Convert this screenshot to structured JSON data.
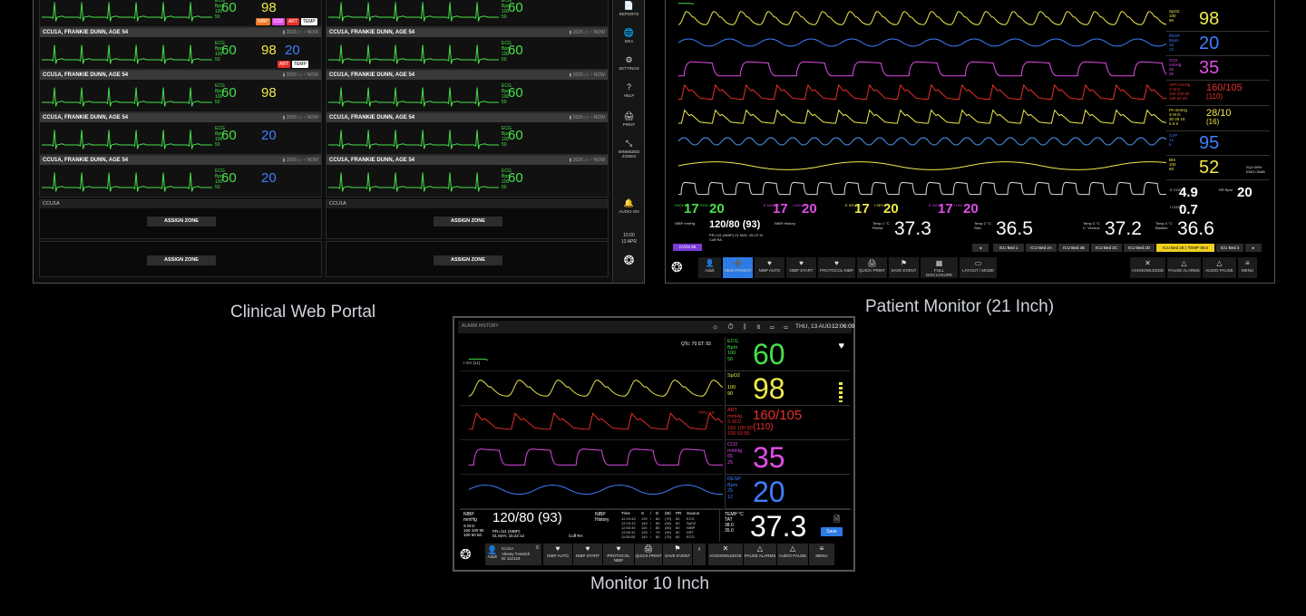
{
  "labels": {
    "portal": "Clinical Web Portal",
    "pm21": "Patient Monitor (21 Inch)",
    "m10": "Monitor 10 Inch"
  },
  "colors": {
    "ecg": "#47e04a",
    "spo2": "#f0e94a",
    "resp": "#3f7fff",
    "co2": "#e14ce8",
    "art": "#e8302a",
    "cvp": "#4aa0ff",
    "temp": "#ffffff",
    "accent": "#2c7be5"
  },
  "portal": {
    "patients": [
      {
        "name": "CCU1A, FRANKIE DUNN, AGE 54",
        "hr": "60",
        "sp": "98",
        "sp_type": "spo2",
        "tags": [
          "NIBP",
          "CO2",
          "ART",
          "TEMP"
        ]
      },
      {
        "name": "CCU1A, FRANKIE DUNN, AGE 54",
        "hr": "60",
        "sp": "98",
        "sp_type": "spo2",
        "tags": [
          "ART",
          "TEMP"
        ],
        "rr": "20"
      },
      {
        "name": "CCU1A, FRANKIE DUNN, AGE 54",
        "hr": "60",
        "sp": "98",
        "sp_type": "spo2",
        "tags": []
      },
      {
        "name": "CCU1A, FRANKIE DUNN, AGE 54",
        "hr": "60",
        "sp": "20",
        "sp_type": "resp",
        "tags": []
      },
      {
        "name": "CCU1A, FRANKIE DUNN, AGE 54",
        "hr": "60",
        "sp": "20",
        "sp_type": "resp",
        "tags": []
      }
    ],
    "right_patients": [
      {
        "name": "CCU1A, FRANKIE DUNN, AGE 54",
        "hr": "60"
      },
      {
        "name": "CCU1A, FRANKIE DUNN, AGE 54",
        "hr": "60"
      },
      {
        "name": "CCU1A, FRANKIE DUNN, AGE 54",
        "hr": "60"
      },
      {
        "name": "CCU1A, FRANKIE DUNN, AGE 54",
        "hr": "60"
      },
      {
        "name": "CCU1A, FRANKIE DUNN, AGE 54",
        "hr": "60"
      }
    ],
    "zone_header": "CCU1A",
    "assign_label": "ASSIGN ZONE",
    "sidebar": [
      {
        "icon": "📄",
        "label": "REPORTS"
      },
      {
        "icon": "🌐",
        "label": "DNA"
      },
      {
        "icon": "⚙",
        "label": "SETTINGS"
      },
      {
        "icon": "?",
        "label": "HELP"
      },
      {
        "icon": "🖨",
        "label": "PRINT"
      },
      {
        "icon": "⤡",
        "label": "MINIMIZED ZONES"
      },
      {
        "icon": "🔔",
        "label": "AUDIO ON"
      }
    ],
    "time": "15:00",
    "date": "13 APR"
  },
  "pm21": {
    "params": [
      {
        "label": "SpO2\n100\n90",
        "value": "98",
        "color": "spo2"
      },
      {
        "label": "RESP\nBrpm\n25\n12",
        "value": "20",
        "color": "resp"
      },
      {
        "label": "CO2\nmmHg\n55\n25",
        "value": "35",
        "color": "co2"
      },
      {
        "label": "ART mmHg\nS M D\n160 100 90\n100 60 50",
        "value": "160/105",
        "sub": "(110)",
        "color": "art"
      },
      {
        "label": "PA mmHg\nS M D\n30 25 15\n5 5 5",
        "value": "28/10",
        "sub": "(16)",
        "color": "spo2"
      },
      {
        "label": "CVP\n12\n6",
        "value": "95",
        "color": "resp"
      },
      {
        "label": "BIS\n100\n60",
        "value": "52",
        "color": "spo2",
        "extra": "SQI=96%\nEMG=35dB"
      }
    ],
    "gases": [
      {
        "label": "FeO2 %",
        "value": "17",
        "color": "ecg"
      },
      {
        "label": "FiO2",
        "value": "20",
        "color": "ecg"
      },
      {
        "label": "E N2O %",
        "value": "17",
        "color": "co2"
      },
      {
        "label": "I N2O",
        "value": "20",
        "color": "co2"
      },
      {
        "label": "E SEV %",
        "value": "17",
        "color": "spo2"
      },
      {
        "label": "I SEV",
        "value": "20",
        "color": "spo2"
      },
      {
        "label": "E ISO %",
        "value": "17",
        "color": "co2"
      },
      {
        "label": "I ISO",
        "value": "20",
        "color": "co2"
      }
    ],
    "eco2": {
      "label": "E CO2%",
      "value": "4.9"
    },
    "rr": {
      "label": "RR Bpm",
      "value": "20"
    },
    "ico2": {
      "label": "I CO2%",
      "value": "0.7"
    },
    "nibp": {
      "label": "NIBP mmHg",
      "value": "120/80 (93)",
      "detail": "PR=111 (NIBP) 01 MAY, 15:22:12",
      "cuff": "Cuff RA"
    },
    "temps": [
      {
        "label": "Temp 1 °C\nRectal",
        "value": "37.3"
      },
      {
        "label": "Temp 2 °C\nSkin",
        "value": "36.5"
      },
      {
        "label": "Temp 3 °C\nC. Venous",
        "value": "37.2"
      },
      {
        "label": "Temp 4 °C\nBladder",
        "value": "36.6"
      }
    ],
    "beds": [
      "ICU Bed 1",
      "ICU Bed 2A",
      "ICU Bed 2B",
      "ICU Bed 2C",
      "ICU Bed 2D",
      "ICU Bed 2E | TEMP 39.6",
      "ICU Bed 3"
    ],
    "tag": "CVO2 85",
    "toolbar": [
      {
        "icon": "👤",
        "label": "Adult"
      },
      {
        "icon": "➕",
        "label": "NEW PATIENT"
      },
      {
        "icon": "♥",
        "label": "NIBP AUTO"
      },
      {
        "icon": "♥",
        "label": "NIBP START"
      },
      {
        "icon": "♥",
        "label": "PROTOCOL NIBP"
      },
      {
        "icon": "🖨",
        "label": "QUICK PRINT"
      },
      {
        "icon": "⚑",
        "label": "SAVE EVENT"
      },
      {
        "icon": "▦",
        "label": "FULL DISCLOSURE"
      },
      {
        "icon": "▭",
        "label": "LAYOUT / MODE"
      }
    ],
    "alarm_toolbar": [
      {
        "icon": "✕",
        "label": "ACKNOWLEDGE"
      },
      {
        "icon": "△",
        "label": "PAUSE ALARMS"
      },
      {
        "icon": "△",
        "label": "AUDIO PAUSE"
      },
      {
        "icon": "≡",
        "label": "MENU"
      }
    ]
  },
  "m10": {
    "status": {
      "tab": "ALARM HISTORY",
      "date": "THU, 13 AUG",
      "time": "12:06:09"
    },
    "qt": "QTc: 70   ST: 93",
    "lead": "I mV (x1)",
    "params": [
      {
        "label": "ECG\nBpm\n100\n50",
        "value": "60",
        "color": "ecg"
      },
      {
        "label": "SpO2\n\n100\n90",
        "value": "98",
        "color": "spo2"
      },
      {
        "label": "ART\nmmHg\nS M D\n160 100 90\n100 60 50",
        "value": "160/105",
        "sub": "(110)",
        "color": "art"
      },
      {
        "label": "CO2\nmmHg\n55\n25",
        "value": "35",
        "color": "co2"
      },
      {
        "label": "RESP\nBpm\n25\n12",
        "value": "20",
        "color": "resp"
      }
    ],
    "ppv": "PPV: 10",
    "nibp": {
      "label": "NIBP\nmmHg",
      "value": "120/80 (93)",
      "detail": "PR=111 (NIBP)\n01 MAY, 15:22:12",
      "limits": "S M D\n160 100 90\n100 60 50",
      "cuff": "Cuff RA"
    },
    "history": {
      "label": "NIBP\nHistory",
      "headers": [
        "Time",
        "S",
        "/",
        "D",
        "(M)",
        "PR",
        "Source"
      ],
      "rows": [
        [
          "12:15:43",
          "120",
          "/",
          "80",
          "(70)",
          "60",
          "ECG"
        ],
        [
          "12:15:12",
          "140",
          "/",
          "85",
          "(95)",
          "60",
          "SpO2"
        ],
        [
          "12:00:34",
          "110",
          "/",
          "80",
          "(80)",
          "60",
          "NIBP"
        ],
        [
          "12:00:32",
          "120",
          "/",
          "70",
          "(90)",
          "60",
          "ART"
        ],
        [
          "11:55:05",
          "140",
          "/",
          "80",
          "(70)",
          "60",
          "ECG"
        ]
      ]
    },
    "temp": {
      "label": "TEMP °C\nTAT\n38.0\n35.0",
      "value": "37.3",
      "save": "Save"
    },
    "patient": {
      "mode": "Adult",
      "bed": "ICU1A",
      "name": "Alexey Tvestich",
      "id": "ID 112123"
    },
    "toolbar": [
      {
        "icon": "♥",
        "label": "NIBP AUTO"
      },
      {
        "icon": "♥",
        "label": "NIBP START"
      },
      {
        "icon": "♥",
        "label": "PROTOCOL NIBP"
      },
      {
        "icon": "🖨",
        "label": "QUICK PRINT"
      },
      {
        "icon": "⚑",
        "label": "SAVE EVENT"
      },
      {
        "icon": "›",
        "label": ""
      },
      {
        "icon": "✕",
        "label": "ACKNOWLEDGE"
      },
      {
        "icon": "△",
        "label": "PAUSE ALARMS"
      },
      {
        "icon": "△",
        "label": "AUDIO PAUSE"
      },
      {
        "icon": "≡",
        "label": "MENU"
      }
    ]
  }
}
